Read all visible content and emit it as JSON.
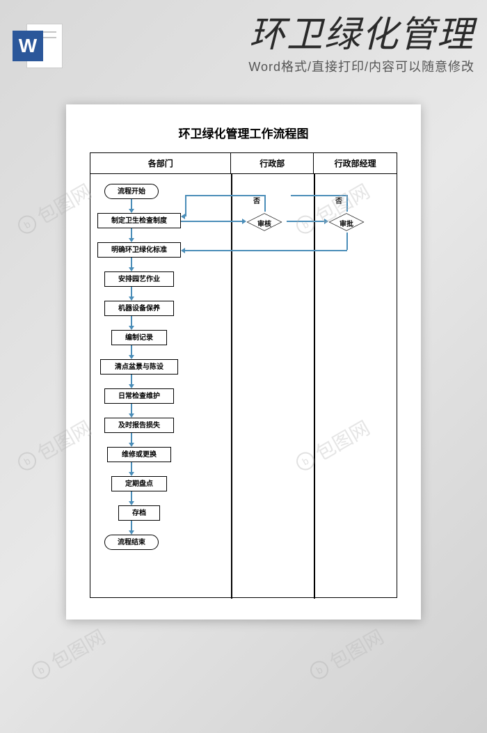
{
  "header": {
    "title": "环卫绿化管理",
    "subtitle": "Word格式/直接打印/内容可以随意修改",
    "icon_letter": "W"
  },
  "watermark": "包图网",
  "document": {
    "title": "环卫绿化管理工作流程图",
    "lanes": [
      "各部门",
      "行政部",
      "行政部经理"
    ],
    "labels": {
      "no": "否"
    },
    "nodes": {
      "start": "流程开始",
      "step1": "制定卫生检查制度",
      "step2": "明确环卫绿化标准",
      "step3": "安排园艺作业",
      "step4": "机器设备保养",
      "step5": "编制记录",
      "step6": "清点盆景与陈设",
      "step7": "日常检查维护",
      "step8": "及时报告损失",
      "step9": "维修或更换",
      "step10": "定期盘点",
      "step11": "存档",
      "end": "流程结束",
      "review": "审核",
      "approve": "审批"
    }
  }
}
